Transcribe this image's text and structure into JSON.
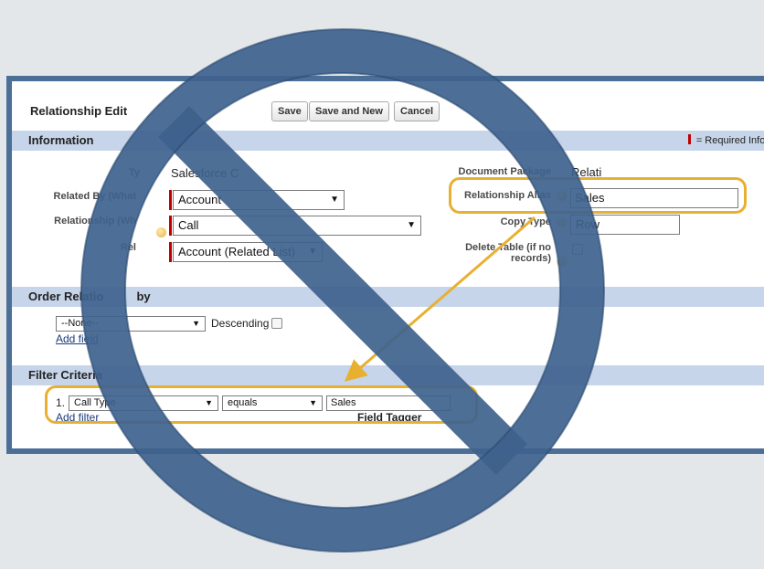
{
  "header": {
    "title": "Relationship Edit",
    "buttons": {
      "save": "Save",
      "save_new": "Save and New",
      "cancel": "Cancel"
    }
  },
  "information": {
    "section_title": "Information",
    "required_legend": "= Required Infor",
    "type_label": "Ty",
    "type_value": "Salesforce C",
    "related_by_label": "Related By (What",
    "related_by_value": "Account",
    "relationship_label": "Relationship (Wh",
    "relationship_value": "Call",
    "rel_label": "Rel",
    "rel_value": "Account (Related List)",
    "document_package_label": "Document Package",
    "document_package_value": "Relati",
    "relationship_alias_label": "Relationship Alias",
    "relationship_alias_value": "Sales",
    "copy_type_label": "Copy Type",
    "copy_type_value": "Row",
    "delete_table_label_1": "Delete Table (if no",
    "delete_table_label_2": "records)"
  },
  "order": {
    "section_title": "Order Relatio          by",
    "select_value": "--None--",
    "descending_label": "Descending",
    "add_field_link": "Add field"
  },
  "filter": {
    "section_title": "Filter Criteria",
    "row_number": "1.",
    "field_value": "Call Type",
    "operator_value": "equals",
    "value": "Sales",
    "add_filter_link": "Add filter",
    "field_tagger_label": "Field Tagger"
  },
  "overlay": {
    "highlight_color": "#e8b030",
    "prohibition_color": "#4b6f97"
  }
}
